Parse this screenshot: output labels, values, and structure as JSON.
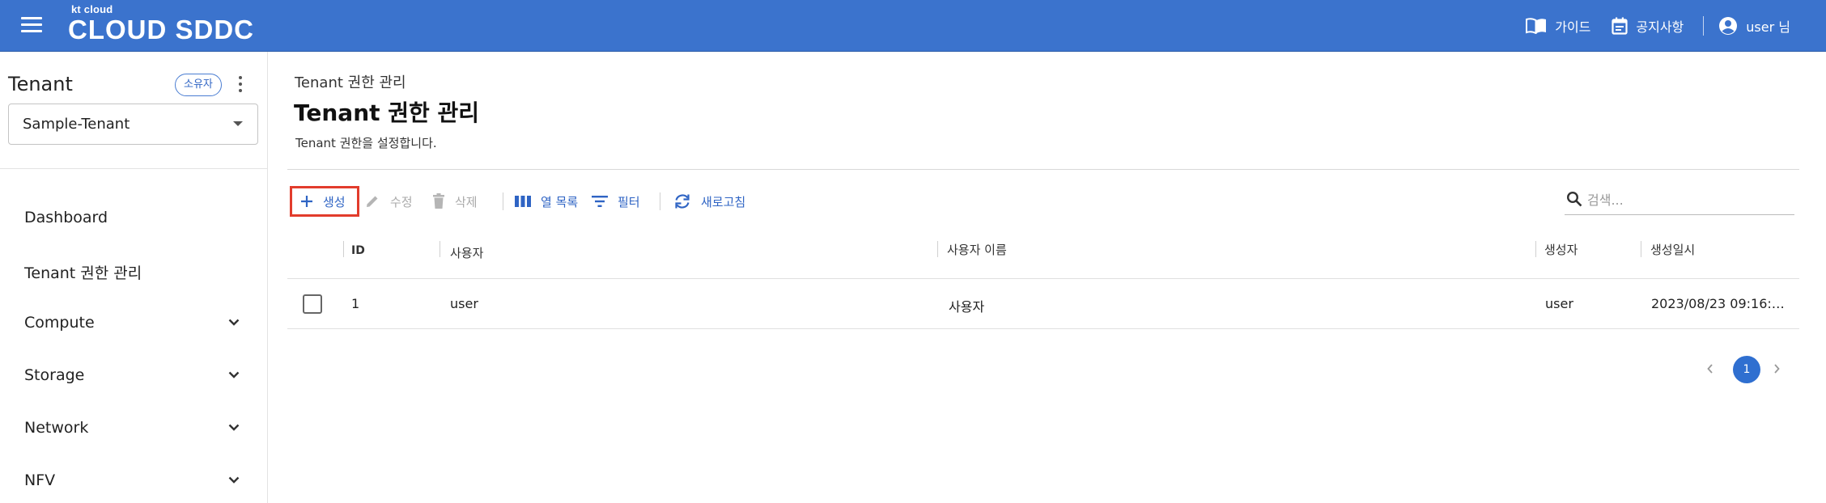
{
  "topbar": {
    "logo_small": "kt cloud",
    "logo_main": "CLOUD SDDC",
    "guide_label": "가이드",
    "notice_label": "공지사항",
    "user_label": "user 님"
  },
  "sidebar": {
    "tenant_heading": "Tenant",
    "owner_badge": "소유자",
    "tenant_select_value": "Sample-Tenant",
    "items": [
      {
        "label": "Dashboard"
      },
      {
        "label": "Tenant 권한 관리"
      },
      {
        "label": "Compute"
      },
      {
        "label": "Storage"
      },
      {
        "label": "Network"
      },
      {
        "label": "NFV"
      }
    ]
  },
  "main": {
    "breadcrumb": "Tenant 권한 관리",
    "title": "Tenant 권한 관리",
    "description": "Tenant 권한을 설정합니다."
  },
  "toolbar": {
    "create_label": "생성",
    "edit_label": "수정",
    "delete_label": "삭제",
    "columns_label": "열 목록",
    "filter_label": "필터",
    "refresh_label": "새로고침",
    "search_placeholder": "검색..."
  },
  "table": {
    "headers": [
      "ID",
      "사용자",
      "사용자 이름",
      "생성자",
      "생성일시"
    ],
    "rows": [
      {
        "id": "1",
        "user": "user",
        "user_name": "사용자",
        "creator": "user",
        "created_at": "2023/08/23 09:16:…"
      }
    ]
  },
  "pagination": {
    "current_page": "1"
  },
  "colors": {
    "topbar": "#3b73cd",
    "accent": "#2f64c4",
    "highlight_box": "#e23c2c"
  }
}
